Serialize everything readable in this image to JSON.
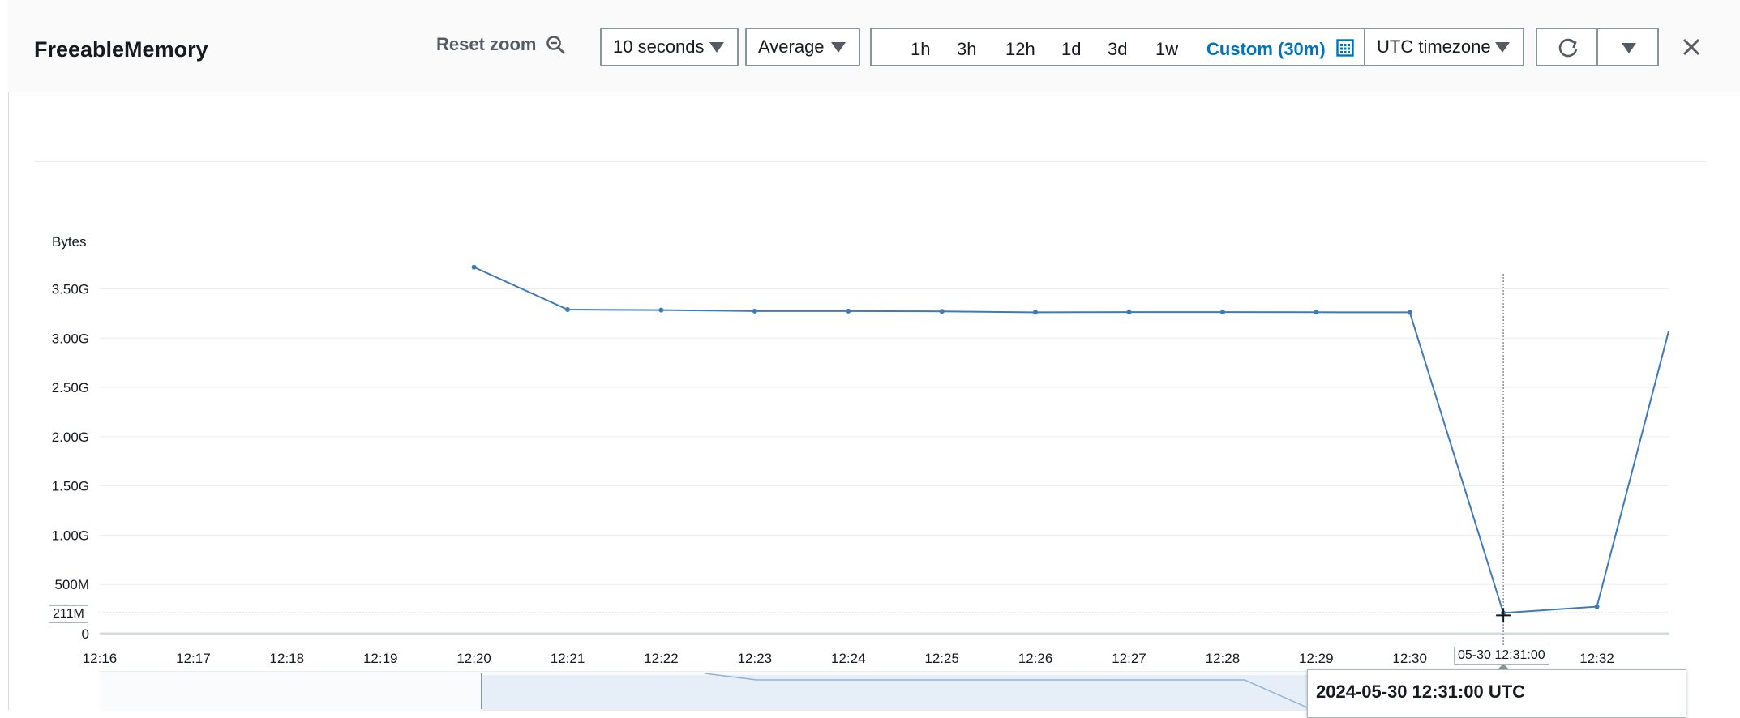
{
  "header": {
    "title": "FreeableMemory",
    "reset_zoom": "Reset zoom",
    "period": "10 seconds",
    "statistic": "Average",
    "ranges": [
      "1h",
      "3h",
      "12h",
      "1d",
      "3d",
      "1w"
    ],
    "custom_range": "Custom (30m)",
    "timezone": "UTC timezone"
  },
  "icons": {
    "reset_zoom": "zoom-out-icon",
    "calendar": "calendar-icon",
    "refresh": "refresh-icon",
    "menu": "caret-down-icon",
    "close": "close-icon"
  },
  "colors": {
    "series": "#3f7ab8",
    "active_range": "#0073bb"
  },
  "chart_data": {
    "type": "line",
    "ylabel": "Bytes",
    "ytick_labels": [
      "0",
      "500M",
      "1.00G",
      "1.50G",
      "2.00G",
      "2.50G",
      "3.00G",
      "3.50G"
    ],
    "yticks": [
      0,
      500,
      1000,
      1500,
      2000,
      2500,
      3000,
      3500
    ],
    "ylim": [
      0,
      3800
    ],
    "xtick_labels": [
      "12:16",
      "12:17",
      "12:18",
      "12:19",
      "12:20",
      "12:21",
      "12:22",
      "12:23",
      "12:24",
      "12:25",
      "12:26",
      "12:27",
      "12:28",
      "12:29",
      "12:30",
      "12:31",
      "12:32"
    ],
    "xlim": [
      "12:16",
      "12:32:46"
    ],
    "series": [
      {
        "x": [
          "12:20",
          "12:21",
          "12:22",
          "12:23",
          "12:24",
          "12:25",
          "12:26",
          "12:27",
          "12:28",
          "12:29",
          "12:30",
          "12:31",
          "12:32",
          "12:32:46"
        ],
        "y": [
          3720,
          3290,
          3285,
          3275,
          3275,
          3272,
          3262,
          3264,
          3264,
          3263,
          3262,
          211,
          275,
          3070
        ]
      }
    ],
    "crosshair": {
      "x_label": "05-30 12:31:00",
      "y_label": "211M",
      "tooltip": "2024-05-30 12:31:00 UTC"
    }
  }
}
